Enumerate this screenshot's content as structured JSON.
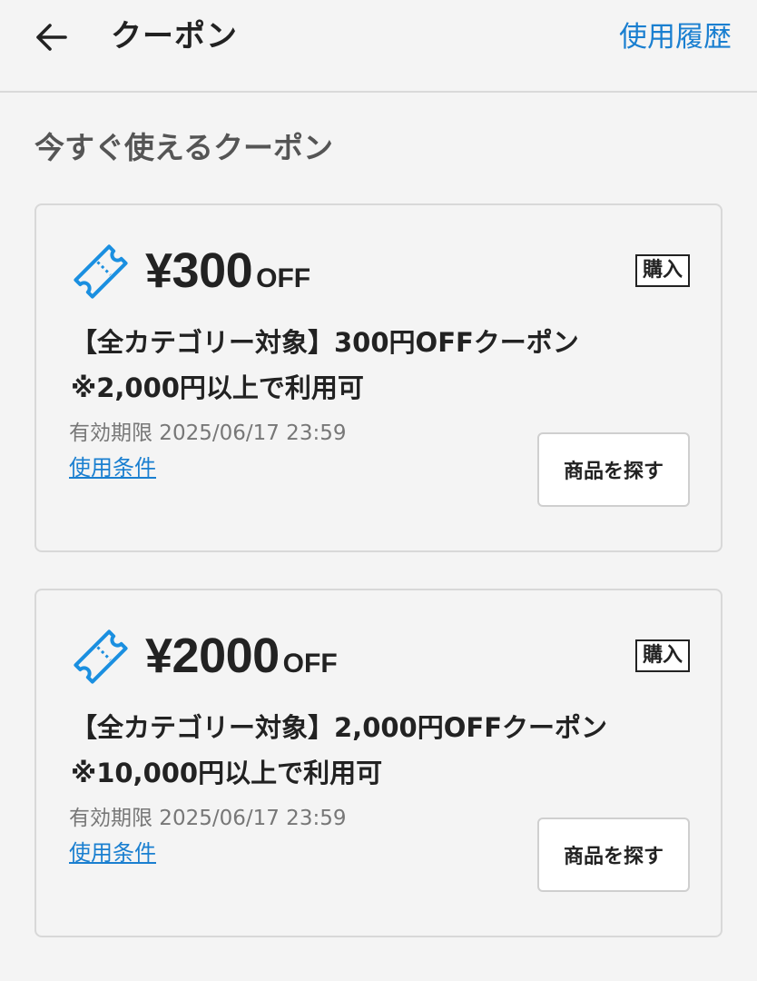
{
  "header": {
    "title": "クーポン",
    "history_link": "使用履歴",
    "back_icon": "arrow-left-icon"
  },
  "section": {
    "title": "今すぐ使えるクーポン"
  },
  "colors": {
    "accent": "#1a7fd0",
    "text": "#222222",
    "muted": "#777777"
  },
  "coupons": [
    {
      "icon": "ticket-icon",
      "amount": "¥300",
      "off_label": "OFF",
      "badge": "購入",
      "title": "【全カテゴリー対象】300円OFFクーポン",
      "condition": "※2,000円以上で利用可",
      "expiry": "有効期限 2025/06/17 23:59",
      "terms_link": "使用条件",
      "button": "商品を探す"
    },
    {
      "icon": "ticket-icon",
      "amount": "¥2000",
      "off_label": "OFF",
      "badge": "購入",
      "title": "【全カテゴリー対象】2,000円OFFクーポン",
      "condition": "※10,000円以上で利用可",
      "expiry": "有効期限 2025/06/17 23:59",
      "terms_link": "使用条件",
      "button": "商品を探す"
    }
  ]
}
